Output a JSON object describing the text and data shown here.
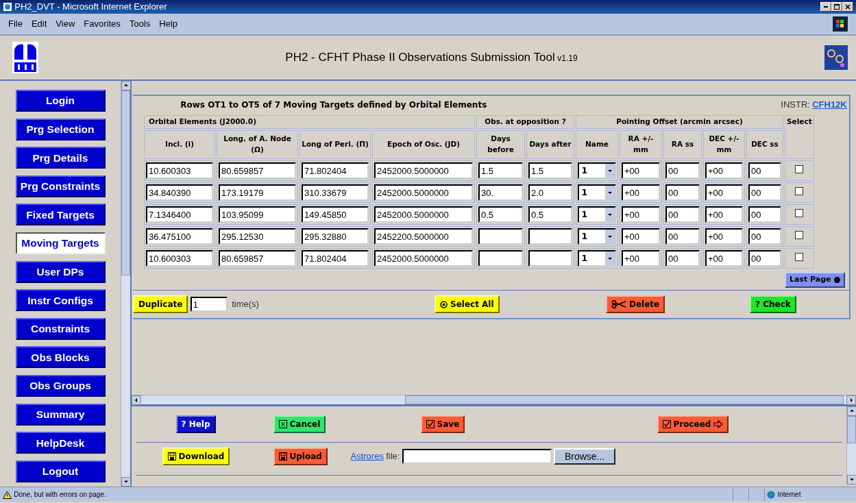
{
  "window": {
    "title": "PH2_DVT - Microsoft Internet Explorer",
    "menu": [
      "File",
      "Edit",
      "View",
      "Favorites",
      "Tools",
      "Help"
    ]
  },
  "header": {
    "title": "PH2 - CFHT Phase II Observations Submission Tool",
    "version": "v1.19"
  },
  "sidebar": {
    "items": [
      {
        "label": "Login",
        "selected": false
      },
      {
        "label": "Prg Selection",
        "selected": false
      },
      {
        "label": "Prg Details",
        "selected": false
      },
      {
        "label": "Prg Constraints",
        "selected": false
      },
      {
        "label": "Fixed Targets",
        "selected": false
      },
      {
        "label": "Moving Targets",
        "selected": true
      },
      {
        "label": "User DPs",
        "selected": false
      },
      {
        "label": "Instr Configs",
        "selected": false
      },
      {
        "label": "Constraints",
        "selected": false
      },
      {
        "label": "Obs Blocks",
        "selected": false
      },
      {
        "label": "Obs Groups",
        "selected": false
      },
      {
        "label": "Summary",
        "selected": false
      },
      {
        "label": "HelpDesk",
        "selected": false
      },
      {
        "label": "Logout",
        "selected": false
      }
    ]
  },
  "table_panel": {
    "title": "Rows OT1 to OT5 of 7 Moving Targets defined by Orbital Elements",
    "instr_label": "INSTR:",
    "instr_link": "CFH12K",
    "groups": [
      {
        "label": "Orbital Elements (J2000.0)",
        "columns": [
          {
            "label": "Incl. (i)",
            "kind": "text"
          },
          {
            "label": "Long. of A. Node (Ω)",
            "kind": "text"
          },
          {
            "label": "Long of Peri. (Π)",
            "kind": "text"
          },
          {
            "label": "Epoch of Osc. (JD)",
            "kind": "text"
          }
        ]
      },
      {
        "label": "Obs. at opposition ?",
        "columns": [
          {
            "label": "Days before",
            "kind": "text"
          },
          {
            "label": "Days after",
            "kind": "text"
          }
        ]
      },
      {
        "label": "Pointing Offset (arcmin arcsec)",
        "columns": [
          {
            "label": "Name",
            "kind": "select"
          },
          {
            "label": "RA +/-mm",
            "kind": "text"
          },
          {
            "label": "RA ss",
            "kind": "text"
          },
          {
            "label": "DEC +/- mm",
            "kind": "text"
          },
          {
            "label": "DEC ss",
            "kind": "text"
          }
        ]
      },
      {
        "label": "Select"
      }
    ],
    "rows": [
      {
        "orbital": [
          "10.600303",
          "80.659857",
          "71.802404",
          "2452000.5000000"
        ],
        "days_before": "1.5",
        "days_after": "1.5",
        "pointing": [
          "1",
          "+00",
          "00",
          "+00",
          "00"
        ],
        "checked": false
      },
      {
        "orbital": [
          "34.840390",
          "173.19179",
          "310.33679",
          "2452000.5000000"
        ],
        "days_before": "30.",
        "days_after": "2.0",
        "pointing": [
          "1",
          "+00",
          "00",
          "+00",
          "00"
        ],
        "checked": false
      },
      {
        "orbital": [
          "7.1346400",
          "103.95099",
          "149.45850",
          "2452000.5000000"
        ],
        "days_before": "0.5",
        "days_after": "0.5",
        "pointing": [
          "1",
          "+00",
          "00",
          "+00",
          "00"
        ],
        "checked": false
      },
      {
        "orbital": [
          "36.475100",
          "295.12530",
          "295.32880",
          "2452200.5000000"
        ],
        "pointing": [
          "1",
          "+00",
          "00",
          "+00",
          "00"
        ],
        "checked": false
      },
      {
        "orbital": [
          "10.600303",
          "80.659857",
          "71.802404",
          "2452000.5000000"
        ],
        "pointing": [
          "1",
          "+00",
          "00",
          "+00",
          "00"
        ],
        "checked": false
      }
    ],
    "last_page": "Last Page",
    "duplicate": {
      "label": "Duplicate",
      "count": "1",
      "suffix": "time(s)"
    },
    "actions": [
      {
        "label": "Select All",
        "kind": "select"
      },
      {
        "label": "Delete",
        "kind": "delete"
      },
      {
        "label": "? Check",
        "kind": "check"
      }
    ]
  },
  "bottom": {
    "row1": [
      {
        "label": "? Help",
        "kind": "help"
      },
      {
        "label": "Cancel",
        "kind": "cancel"
      },
      {
        "label": "Save",
        "kind": "save"
      },
      {
        "label": "Proceed",
        "kind": "proceed"
      }
    ],
    "row2": [
      {
        "label": "Download",
        "kind": "download"
      },
      {
        "label": "Upload",
        "kind": "upload"
      }
    ],
    "file_link": "Astrores",
    "file_label": "file:",
    "browse": "Browse..."
  },
  "status_bar": {
    "text": "Done, but with errors on page.",
    "zone": "Internet"
  }
}
